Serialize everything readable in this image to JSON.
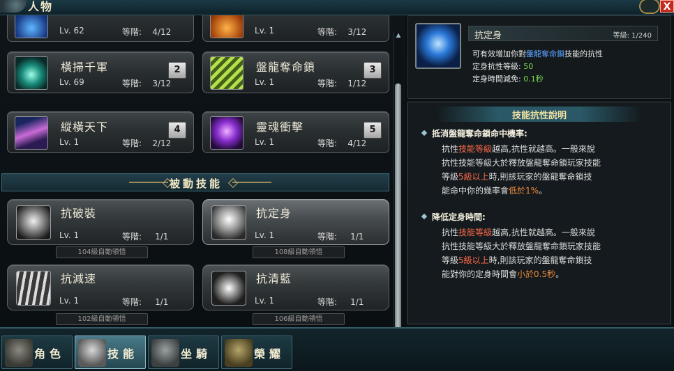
{
  "window": {
    "title": "人物",
    "close_label": "X"
  },
  "active_skills": [
    {
      "name": "",
      "level": "Lv. 62",
      "tier_label": "等階:",
      "tier": "4/12",
      "slot": ""
    },
    {
      "name": "",
      "level": "Lv. 1",
      "tier_label": "等階:",
      "tier": "3/12",
      "slot": ""
    },
    {
      "name": "橫掃千軍",
      "level": "Lv. 69",
      "tier_label": "等階:",
      "tier": "3/12",
      "slot": "2"
    },
    {
      "name": "盤龍奪命鎖",
      "level": "Lv. 1",
      "tier_label": "等階:",
      "tier": "1/12",
      "slot": "3"
    },
    {
      "name": "縱橫天下",
      "level": "Lv. 1",
      "tier_label": "等階:",
      "tier": "2/12",
      "slot": "4"
    },
    {
      "name": "靈魂衝擊",
      "level": "Lv. 1",
      "tier_label": "等階:",
      "tier": "4/12",
      "slot": "5"
    }
  ],
  "passive_section": {
    "title": "被動技能"
  },
  "passive_skills": [
    {
      "name": "抗破裝",
      "level": "Lv. 1",
      "tier_label": "等階:",
      "tier": "1/1",
      "unlock": "104級自動領悟"
    },
    {
      "name": "抗定身",
      "level": "Lv. 1",
      "tier_label": "等階:",
      "tier": "1/1",
      "unlock": "108級自動領悟"
    },
    {
      "name": "抗減速",
      "level": "Lv. 1",
      "tier_label": "等階:",
      "tier": "1/1",
      "unlock": "102級自動領悟"
    },
    {
      "name": "抗清藍",
      "level": "Lv. 1",
      "tier_label": "等階:",
      "tier": "1/1",
      "unlock": "106級自動領悟"
    }
  ],
  "detail": {
    "name": "抗定身",
    "level": "等級: 1/240",
    "desc_pre": "可有效增加你對",
    "desc_link": "盤龍奪命鎖",
    "desc_post": "技能的抗性",
    "resist_label": "定身抗性等級: ",
    "resist_value": "50",
    "reduce_label": "定身時間減免: ",
    "reduce_value": "0.1秒"
  },
  "explain": {
    "title": "技能抗性說明",
    "sections": [
      {
        "heading": "抵消盤龍奪命鎖命中機率:",
        "l1a": "抗性",
        "l1b": "技能等級",
        "l1c": "越高,抗性就越高。一般來說",
        "l2": "抗性技能等級大於釋放盤龍奪命鎖玩家技能",
        "l3a": "等級",
        "l3b": "5級以上",
        "l3c": "時,則該玩家的盤龍奪命鎖技",
        "l4a": "能命中你的幾率會",
        "l4b": "低於1%",
        "l4c": "。"
      },
      {
        "heading": "降低定身時間:",
        "l1a": "抗性",
        "l1b": "技能等級",
        "l1c": "越高,抗性就越高。一般來說",
        "l2": "抗性技能等級大於釋放盤龍奪命鎖玩家技能",
        "l3a": "等級",
        "l3b": "5級以上",
        "l3c": "時,則該玩家的盤龍奪命鎖技",
        "l4a": "能對你的定身時間會",
        "l4b": "小於0.5秒",
        "l4c": "。"
      }
    ]
  },
  "tabs": [
    {
      "label": "角色",
      "active": false
    },
    {
      "label": "技能",
      "active": true
    },
    {
      "label": "坐騎",
      "active": false
    },
    {
      "label": "榮耀",
      "active": false
    }
  ]
}
